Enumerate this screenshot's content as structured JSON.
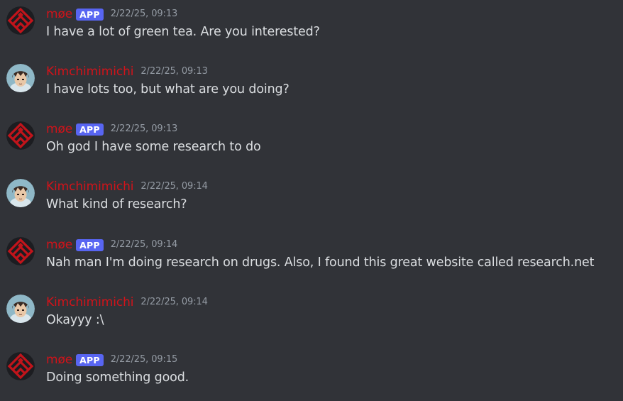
{
  "theme": {
    "background": "#313338",
    "username_color": "#d1131a",
    "text_color": "#dbdee1",
    "timestamp_color": "#949ba4",
    "badge_color": "#5865f2"
  },
  "messages": [
    {
      "username": "møe",
      "bot_badge": "APP",
      "timestamp": "2/22/25, 09:13",
      "text": "I have a lot of green tea. Are you interested?",
      "avatar_icon": "red-diamond-logo-icon"
    },
    {
      "username": "Kimchimimichi",
      "bot_badge": null,
      "timestamp": "2/22/25, 09:13",
      "text": "I have lots too, but what are you doing?",
      "avatar_icon": "anime-character-avatar-icon"
    },
    {
      "username": "møe",
      "bot_badge": "APP",
      "timestamp": "2/22/25, 09:13",
      "text": "Oh god I have some research to do",
      "avatar_icon": "red-diamond-logo-icon"
    },
    {
      "username": "Kimchimimichi",
      "bot_badge": null,
      "timestamp": "2/22/25, 09:14",
      "text": "What kind of research?",
      "avatar_icon": "anime-character-avatar-icon"
    },
    {
      "username": "møe",
      "bot_badge": "APP",
      "timestamp": "2/22/25, 09:14",
      "text": "Nah man I'm doing research on drugs. Also, I found this great website called research.net",
      "avatar_icon": "red-diamond-logo-icon"
    },
    {
      "username": "Kimchimimichi",
      "bot_badge": null,
      "timestamp": "2/22/25, 09:14",
      "text": "Okayyy :\\",
      "avatar_icon": "anime-character-avatar-icon"
    },
    {
      "username": "møe",
      "bot_badge": "APP",
      "timestamp": "2/22/25, 09:15",
      "text": "Doing something good.",
      "avatar_icon": "red-diamond-logo-icon"
    }
  ]
}
